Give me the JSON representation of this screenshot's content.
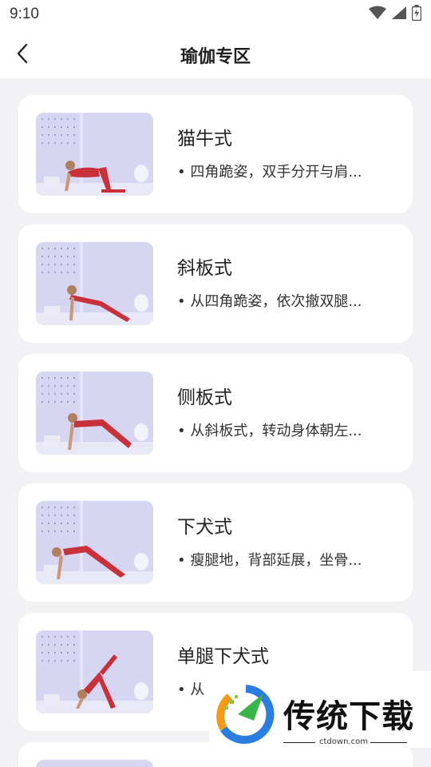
{
  "status_bar": {
    "time": "9:10"
  },
  "header": {
    "title": "瑜伽专区"
  },
  "poses": [
    {
      "name": "猫牛式",
      "desc": "• 四角跪姿，双手分开与肩..."
    },
    {
      "name": "斜板式",
      "desc": "• 从四角跪姿，依次撤双腿..."
    },
    {
      "name": "侧板式",
      "desc": "• 从斜板式，转动身体朝左..."
    },
    {
      "name": "下犬式",
      "desc": "• 瘦腿地，背部延展，坐骨..."
    },
    {
      "name": "单腿下犬式",
      "desc": "• 从"
    }
  ],
  "watermark": {
    "text": "传统下载",
    "url": "ctdown.com"
  },
  "colors": {
    "accent_red": "#c8303a",
    "thumb_bg": "#d7d6f2"
  }
}
